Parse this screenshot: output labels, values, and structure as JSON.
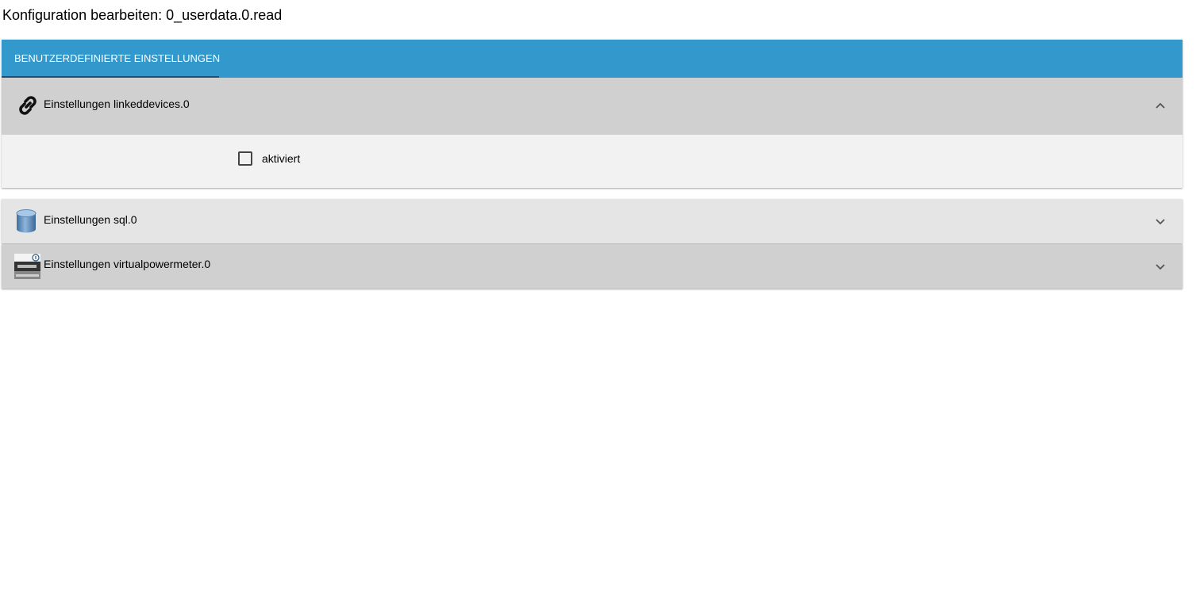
{
  "page": {
    "title": "Konfiguration bearbeiten: 0_userdata.0.read"
  },
  "tabs": [
    {
      "label": "BENUTZERDEFINIERTE EINSTELLUNGEN",
      "active": true
    }
  ],
  "panels": [
    {
      "label": "Einstellungen linkeddevices.0",
      "icon": "link-icon",
      "expanded": true,
      "fields": [
        {
          "type": "checkbox",
          "label": "aktiviert",
          "checked": false
        }
      ]
    },
    {
      "label": "Einstellungen sql.0",
      "icon": "database-icon",
      "expanded": false
    },
    {
      "label": "Einstellungen virtualpowermeter.0",
      "icon": "powermeter-icon",
      "expanded": false
    }
  ],
  "colors": {
    "tab_bar": "#3399cc",
    "tab_indicator": "#1e4f7a",
    "header_expanded": "#d0d0d0",
    "body_bg": "#f2f2f2",
    "header_collapsed": "#e5e5e5"
  }
}
